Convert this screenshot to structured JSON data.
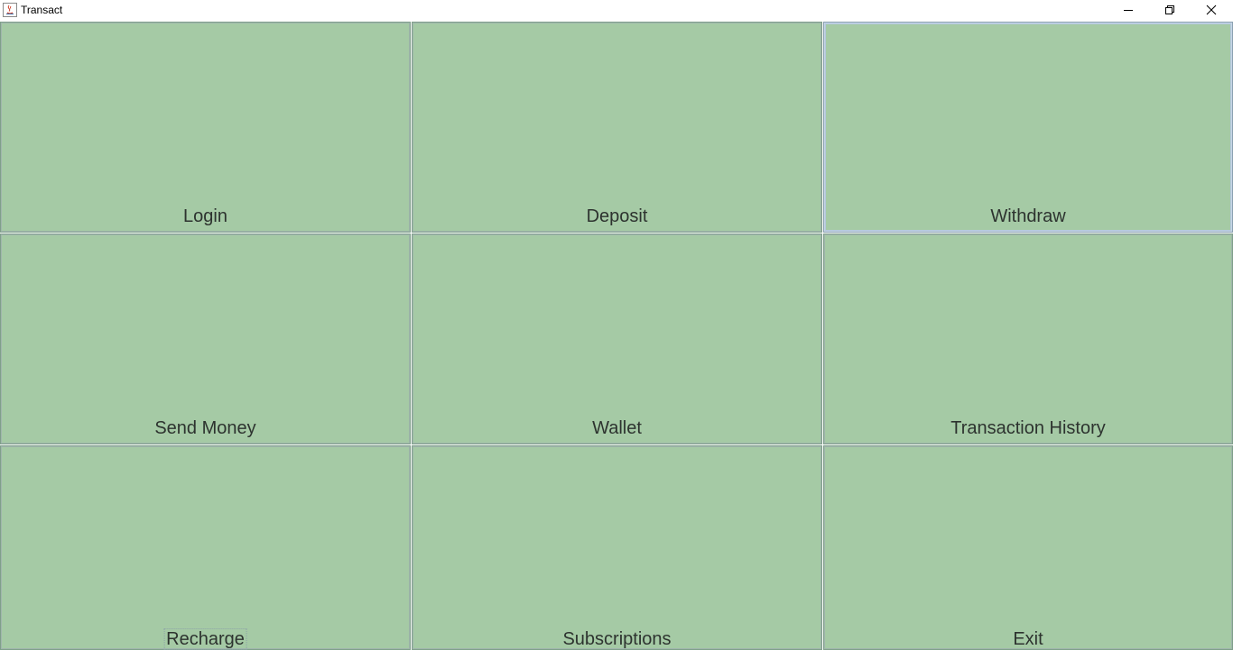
{
  "window": {
    "title": "Transact",
    "controls": {
      "minimize_icon": "minimize-icon",
      "maximize_icon": "restore-icon",
      "close_icon": "close-icon"
    }
  },
  "colors": {
    "tile_background": "#a5caa5",
    "tile_border": "#7f9f8a",
    "label_text": "#2d332f"
  },
  "menu": {
    "login": "Login",
    "deposit": "Deposit",
    "withdraw": "Withdraw",
    "send_money": "Send Money",
    "wallet": "Wallet",
    "transaction_history": "Transaction History",
    "recharge": "Recharge",
    "subscriptions": "Subscriptions",
    "exit": "Exit"
  }
}
